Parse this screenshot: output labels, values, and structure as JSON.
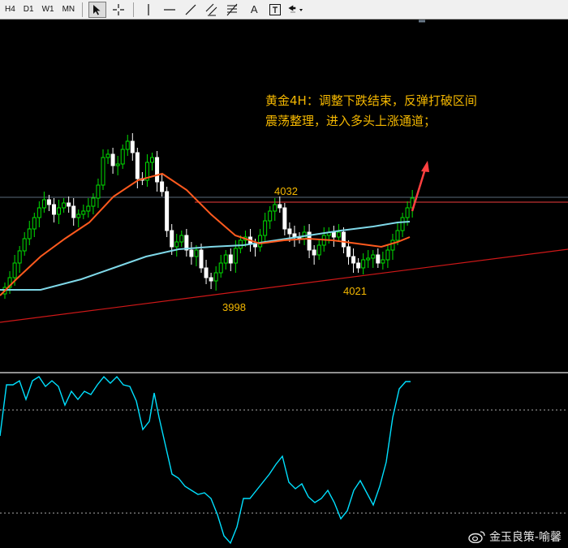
{
  "toolbar": {
    "timeframes": [
      "H4",
      "D1",
      "W1",
      "MN"
    ],
    "text_tool_label": "A"
  },
  "chart": {
    "resistance_label": "4032",
    "low_left_label": "3998",
    "low_right_label": "4021",
    "annotation_line1": "黄金4H：调整下跌结束，反弹打破区间",
    "annotation_line2": "震荡整理，进入多头上涨通道；",
    "colors": {
      "background": "#000000",
      "bull_candle": "#00e000",
      "bear_candle": "#ffffff",
      "ma_fast": "#ff5a1e",
      "ma_slow": "#7fd8e8",
      "resistance_line": "#c03030",
      "trend_line": "#d01818",
      "indicator": "#00e0ff",
      "label": "#f5b800",
      "arrow": "#ff4040"
    }
  },
  "watermark": {
    "text": "金玉良策-喻馨",
    "icon": "weibo-icon"
  }
}
